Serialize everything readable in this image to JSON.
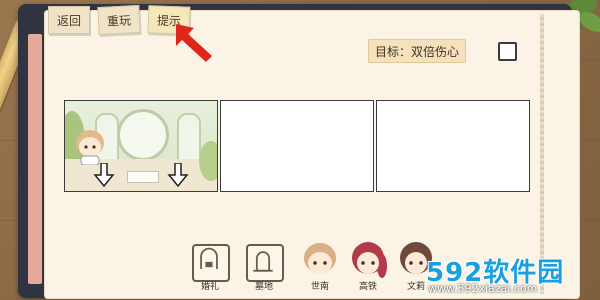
{
  "toolbar": {
    "back_label": "返回",
    "replay_label": "重玩",
    "hint_label": "提示"
  },
  "goal": {
    "label": "目标：双倍伤心",
    "checked": false
  },
  "panels": [
    {
      "filled": true
    },
    {
      "filled": false
    },
    {
      "filled": false
    }
  ],
  "characters": [
    {
      "label": "婚礼",
      "icon": "wedding-card-icon"
    },
    {
      "label": "墓地",
      "icon": "gravestone-card-icon"
    },
    {
      "label": "世南",
      "icon": "boy-portrait-icon"
    },
    {
      "label": "高铁",
      "icon": "red-hair-girl-portrait-icon"
    },
    {
      "label": "文莉",
      "icon": "brown-hair-girl-portrait-icon"
    }
  ],
  "watermark": {
    "title": "592软件园",
    "url": "www.592xiazai.com"
  },
  "colors": {
    "page": "#fbf3e6",
    "accent_arrow": "#e0251b",
    "watermark": "#1aa0e0"
  }
}
